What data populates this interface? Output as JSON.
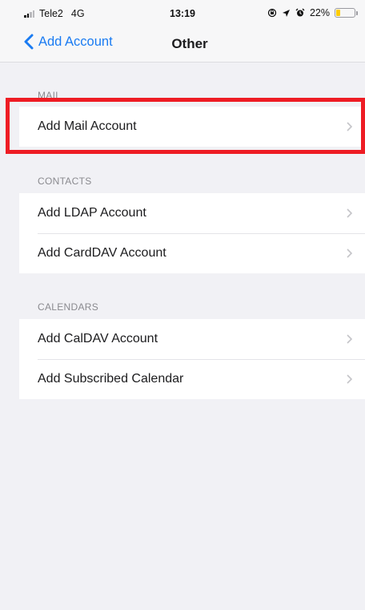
{
  "status_bar": {
    "carrier": "Tele2",
    "network": "4G",
    "time": "13:19",
    "battery_percent": "22%",
    "battery_level": 0.22
  },
  "nav": {
    "back_label": "Add Account",
    "title": "Other"
  },
  "sections": [
    {
      "header": "MAIL",
      "items": [
        {
          "label": "Add Mail Account"
        }
      ]
    },
    {
      "header": "CONTACTS",
      "items": [
        {
          "label": "Add LDAP Account"
        },
        {
          "label": "Add CardDAV Account"
        }
      ]
    },
    {
      "header": "CALENDARS",
      "items": [
        {
          "label": "Add CalDAV Account"
        },
        {
          "label": "Add Subscribed Calendar"
        }
      ]
    }
  ],
  "colors": {
    "accent": "#1a7bf2",
    "highlight": "#ee1c24",
    "battery": "#ffcc00"
  },
  "icons": [
    "signal-icon",
    "chevron-left-icon",
    "lock-rotation-icon",
    "location-icon",
    "alarm-icon",
    "battery-icon",
    "chevron-right-icon"
  ]
}
